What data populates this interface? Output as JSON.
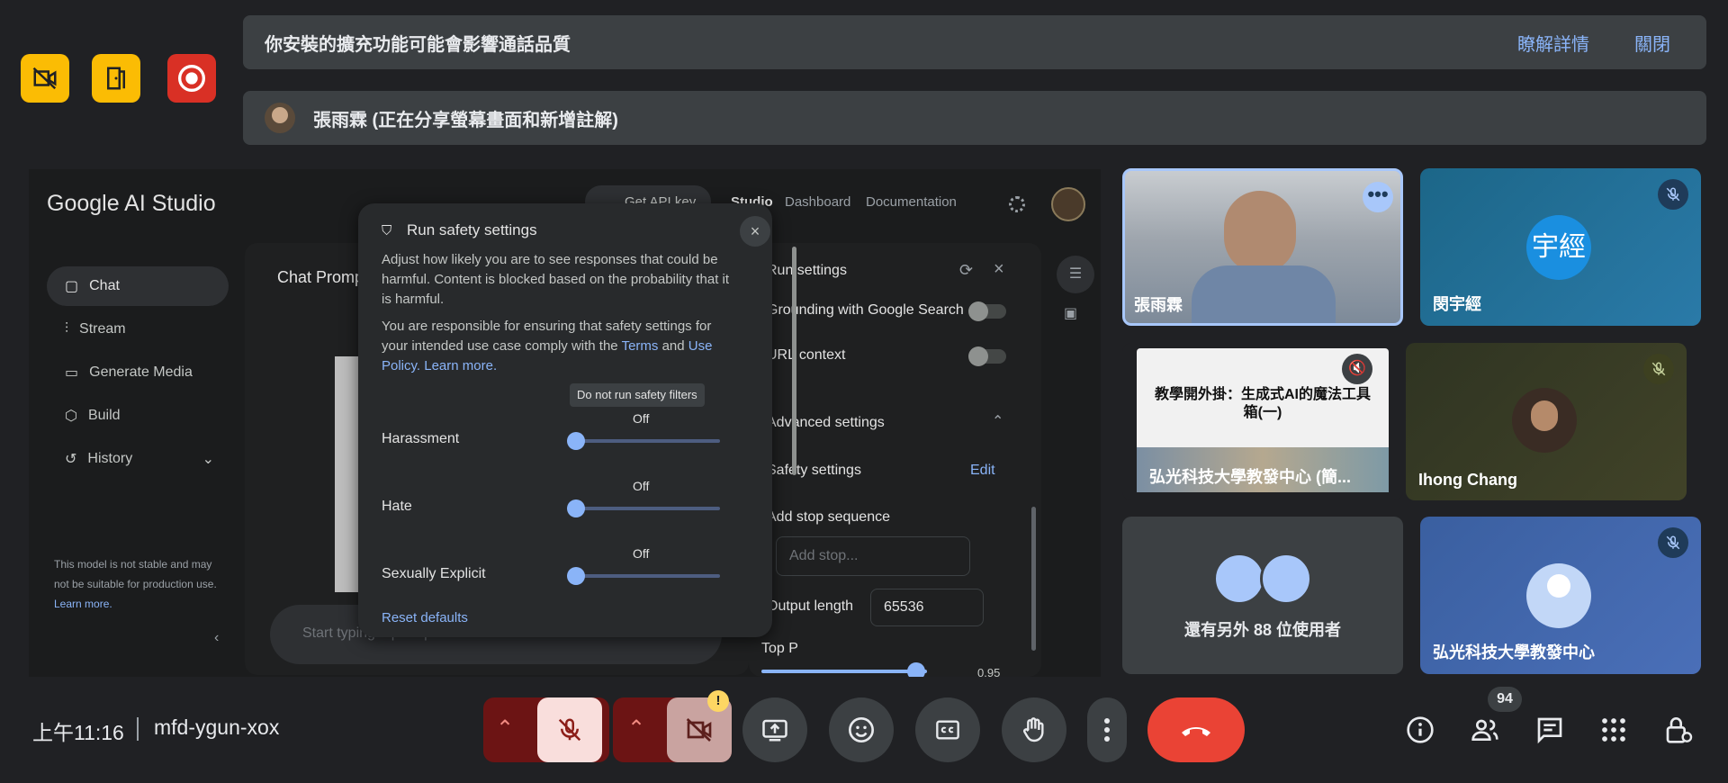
{
  "colors": {
    "accent_yellow": "#fbbc04",
    "danger_red": "#d93025",
    "link_blue": "#8ab4f8",
    "end_call": "#ea4335"
  },
  "top_icons": [
    {
      "icon": "no-video-icon",
      "color": "#fbbc04"
    },
    {
      "icon": "door-exit-icon",
      "color": "#fbbc04"
    },
    {
      "icon": "record-icon",
      "color": "#d93025"
    }
  ],
  "extension_banner": {
    "message": "你安裝的擴充功能可能會影響通話品質",
    "learn_more": "瞭解詳情",
    "close": "關閉"
  },
  "presenter_banner": {
    "text": "張雨霖 (正在分享螢幕畫面和新增註解)"
  },
  "studio": {
    "logo": "Google AI Studio",
    "get_api_key": "Get API key",
    "nav": [
      "Studio",
      "Dashboard",
      "Documentation"
    ],
    "sidebar": [
      {
        "label": "Chat",
        "icon": "chat-icon"
      },
      {
        "label": "Stream",
        "icon": "stream-icon"
      },
      {
        "label": "Generate Media",
        "icon": "media-icon"
      },
      {
        "label": "Build",
        "icon": "build-icon"
      },
      {
        "label": "History",
        "icon": "history-icon"
      }
    ],
    "disclaimer": "This model is not stable and may not be suitable for production use.",
    "disclaimer_link": "Learn more.",
    "chat_title": "Chat Prompt",
    "input_placeholder": "Start typing a prompt",
    "run_settings": {
      "title": "Run settings",
      "grounding": "Grounding with Google Search",
      "url_context": "URL context",
      "advanced": "Advanced settings",
      "safety": "Safety settings",
      "edit": "Edit",
      "stop_sequence": "Add stop sequence",
      "stop_placeholder": "Add stop...",
      "output_length": "Output length",
      "output_length_value": "65536",
      "top_p": "Top P",
      "top_p_value": "0.95"
    },
    "safety_dialog": {
      "title": "Run safety settings",
      "desc1": "Adjust how likely you are to see responses that could be harmful. Content is blocked based on the probability that it is harmful.",
      "desc2_a": "You are responsible for ensuring that safety settings for your intended use case comply with the",
      "terms": "Terms",
      "and": "and",
      "use_policy": "Use Policy",
      "learn_more": "Learn more.",
      "tooltip": "Do not run safety filters",
      "categories": [
        {
          "label": "Harassment",
          "value": "Off",
          "level": 0
        },
        {
          "label": "Hate",
          "value": "Off",
          "level": 0
        },
        {
          "label": "Sexually Explicit",
          "value": "Off",
          "level": 0
        }
      ],
      "reset": "Reset defaults"
    }
  },
  "participants": [
    {
      "name": "張雨霖",
      "type": "video"
    },
    {
      "name": "閔宇經",
      "avatar_text": "宇經",
      "muted": true
    },
    {
      "name": "弘光科技大學教發中心 (簡...",
      "slide_title": "教學開外掛：生成式AI的魔法工具箱(一)",
      "type": "presentation"
    },
    {
      "name": "Ihong Chang",
      "muted": true
    },
    {
      "others_text": "還有另外 88 位使用者"
    },
    {
      "name": "弘光科技大學教發中心",
      "muted": true
    }
  ],
  "bottom": {
    "time": "上午11:16",
    "meeting_code": "mfd-ygun-xox",
    "participant_count": "94"
  }
}
